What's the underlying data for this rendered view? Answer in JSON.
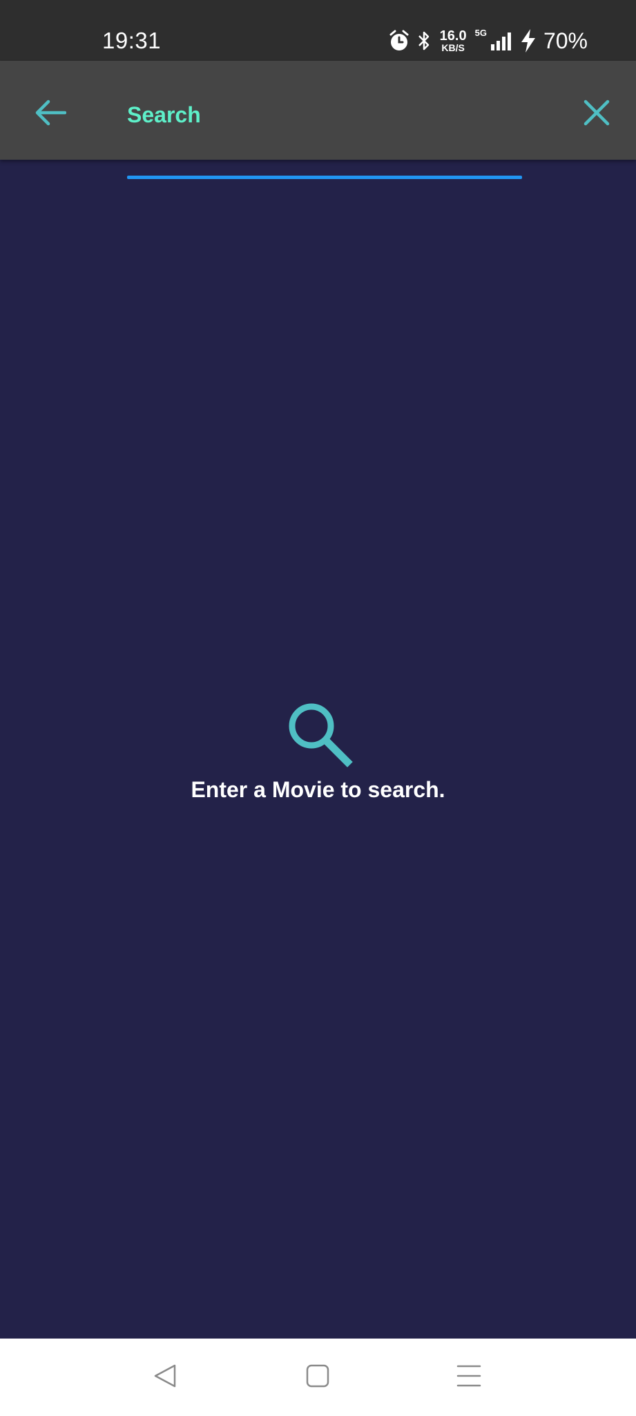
{
  "status_bar": {
    "time": "19:31",
    "net_speed_value": "16.0",
    "net_speed_unit": "KB/S",
    "network_type": "5G",
    "battery_percent": "70%",
    "icons": [
      "alarm-icon",
      "bluetooth-icon",
      "signal-icon",
      "charging-icon"
    ]
  },
  "toolbar": {
    "search_placeholder": "Search",
    "search_value": "",
    "back_icon": "arrow-left-icon",
    "clear_icon": "close-icon"
  },
  "empty_state": {
    "icon": "search-icon",
    "message": "Enter a Movie to search."
  },
  "nav_bar": {
    "buttons": [
      "back-triangle-icon",
      "home-square-icon",
      "menu-lines-icon"
    ]
  },
  "colors": {
    "background": "#232249",
    "toolbar": "#454545",
    "status_bar": "#2e2e2e",
    "accent_teal": "#4fbfc4",
    "search_text": "#5ef0c9",
    "underline": "#2196f3"
  }
}
